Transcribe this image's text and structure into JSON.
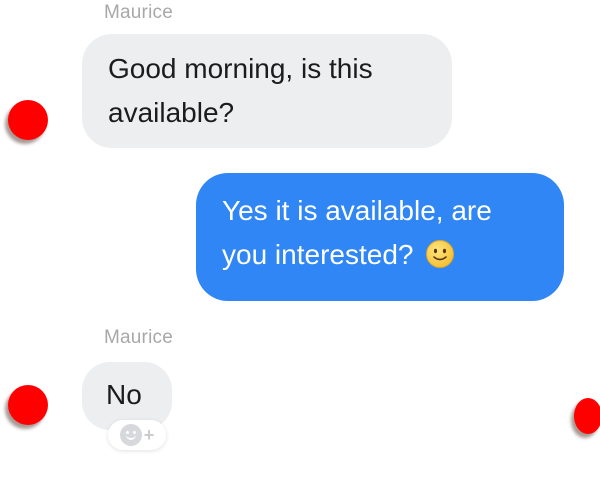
{
  "conversation": {
    "messages": [
      {
        "sender": "Maurice",
        "direction": "incoming",
        "lines": [
          "Good morning, is this",
          "available?"
        ]
      },
      {
        "direction": "outgoing",
        "lines": [
          "Yes it is available, are",
          "you interested?"
        ],
        "emoji": "slightly-smiling-face"
      },
      {
        "sender": "Maurice",
        "direction": "incoming",
        "lines": [
          "No"
        ]
      }
    ]
  },
  "colors": {
    "outgoing_bubble": "#2f86f4",
    "incoming_bubble": "#eceef0",
    "avatar_redaction": "#ff0000",
    "sender_name": "#a8a8a8"
  },
  "icons": {
    "reaction": "add-reaction-icon",
    "emoji": "slightly-smiling-face-emoji"
  }
}
